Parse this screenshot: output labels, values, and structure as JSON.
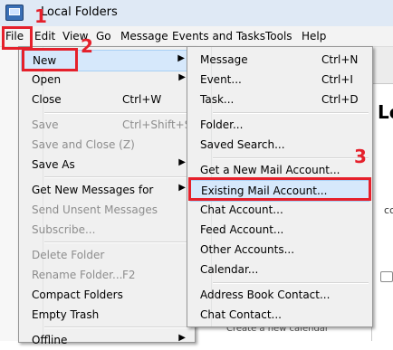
{
  "window": {
    "title": "Local Folders"
  },
  "menubar": [
    {
      "label": "File"
    },
    {
      "label": "Edit"
    },
    {
      "label": "View"
    },
    {
      "label": "Go"
    },
    {
      "label": "Message"
    },
    {
      "label": "Events and Tasks"
    },
    {
      "label": "Tools"
    },
    {
      "label": "Help"
    }
  ],
  "file_menu": [
    {
      "label": "New",
      "accel": "",
      "submenu": true,
      "disabled": false
    },
    {
      "label": "Open",
      "accel": "",
      "submenu": true,
      "disabled": false
    },
    {
      "label": "Close",
      "accel": "Ctrl+W",
      "submenu": false,
      "disabled": false
    },
    {
      "label": "Save",
      "accel": "Ctrl+Shift+S",
      "submenu": false,
      "disabled": true
    },
    {
      "label": "Save and Close (Z)",
      "accel": "",
      "submenu": false,
      "disabled": true
    },
    {
      "label": "Save As",
      "accel": "",
      "submenu": true,
      "disabled": false
    },
    {
      "label": "Get New Messages for",
      "accel": "",
      "submenu": true,
      "disabled": false
    },
    {
      "label": "Send Unsent Messages",
      "accel": "",
      "submenu": false,
      "disabled": true
    },
    {
      "label": "Subscribe...",
      "accel": "",
      "submenu": false,
      "disabled": true
    },
    {
      "label": "Delete Folder",
      "accel": "",
      "submenu": false,
      "disabled": true
    },
    {
      "label": "Rename Folder...",
      "accel": "F2",
      "submenu": false,
      "disabled": true
    },
    {
      "label": "Compact Folders",
      "accel": "",
      "submenu": false,
      "disabled": false
    },
    {
      "label": "Empty Trash",
      "accel": "",
      "submenu": false,
      "disabled": false
    },
    {
      "label": "Offline",
      "accel": "",
      "submenu": true,
      "disabled": false
    }
  ],
  "new_menu": [
    {
      "label": "Message",
      "accel": "Ctrl+N"
    },
    {
      "label": "Event...",
      "accel": "Ctrl+I"
    },
    {
      "label": "Task...",
      "accel": "Ctrl+D"
    },
    {
      "label": "Folder...",
      "accel": ""
    },
    {
      "label": "Saved Search...",
      "accel": ""
    },
    {
      "label": "Get a New Mail Account...",
      "accel": ""
    },
    {
      "label": "Existing Mail Account...",
      "accel": ""
    },
    {
      "label": "Chat Account...",
      "accel": ""
    },
    {
      "label": "Feed Account...",
      "accel": ""
    },
    {
      "label": "Other Accounts...",
      "accel": ""
    },
    {
      "label": "Calendar...",
      "accel": ""
    },
    {
      "label": "Address Book Contact...",
      "accel": ""
    },
    {
      "label": "Chat Contact...",
      "accel": ""
    }
  ],
  "background": {
    "heading": "Lo",
    "line": "cco",
    "bottom": "Create a new calendar"
  },
  "annotations": {
    "step1": "1",
    "step2": "2",
    "step3": "3"
  },
  "colors": {
    "annotation_red": "#e5202b",
    "highlight": "#d6e8fb"
  }
}
